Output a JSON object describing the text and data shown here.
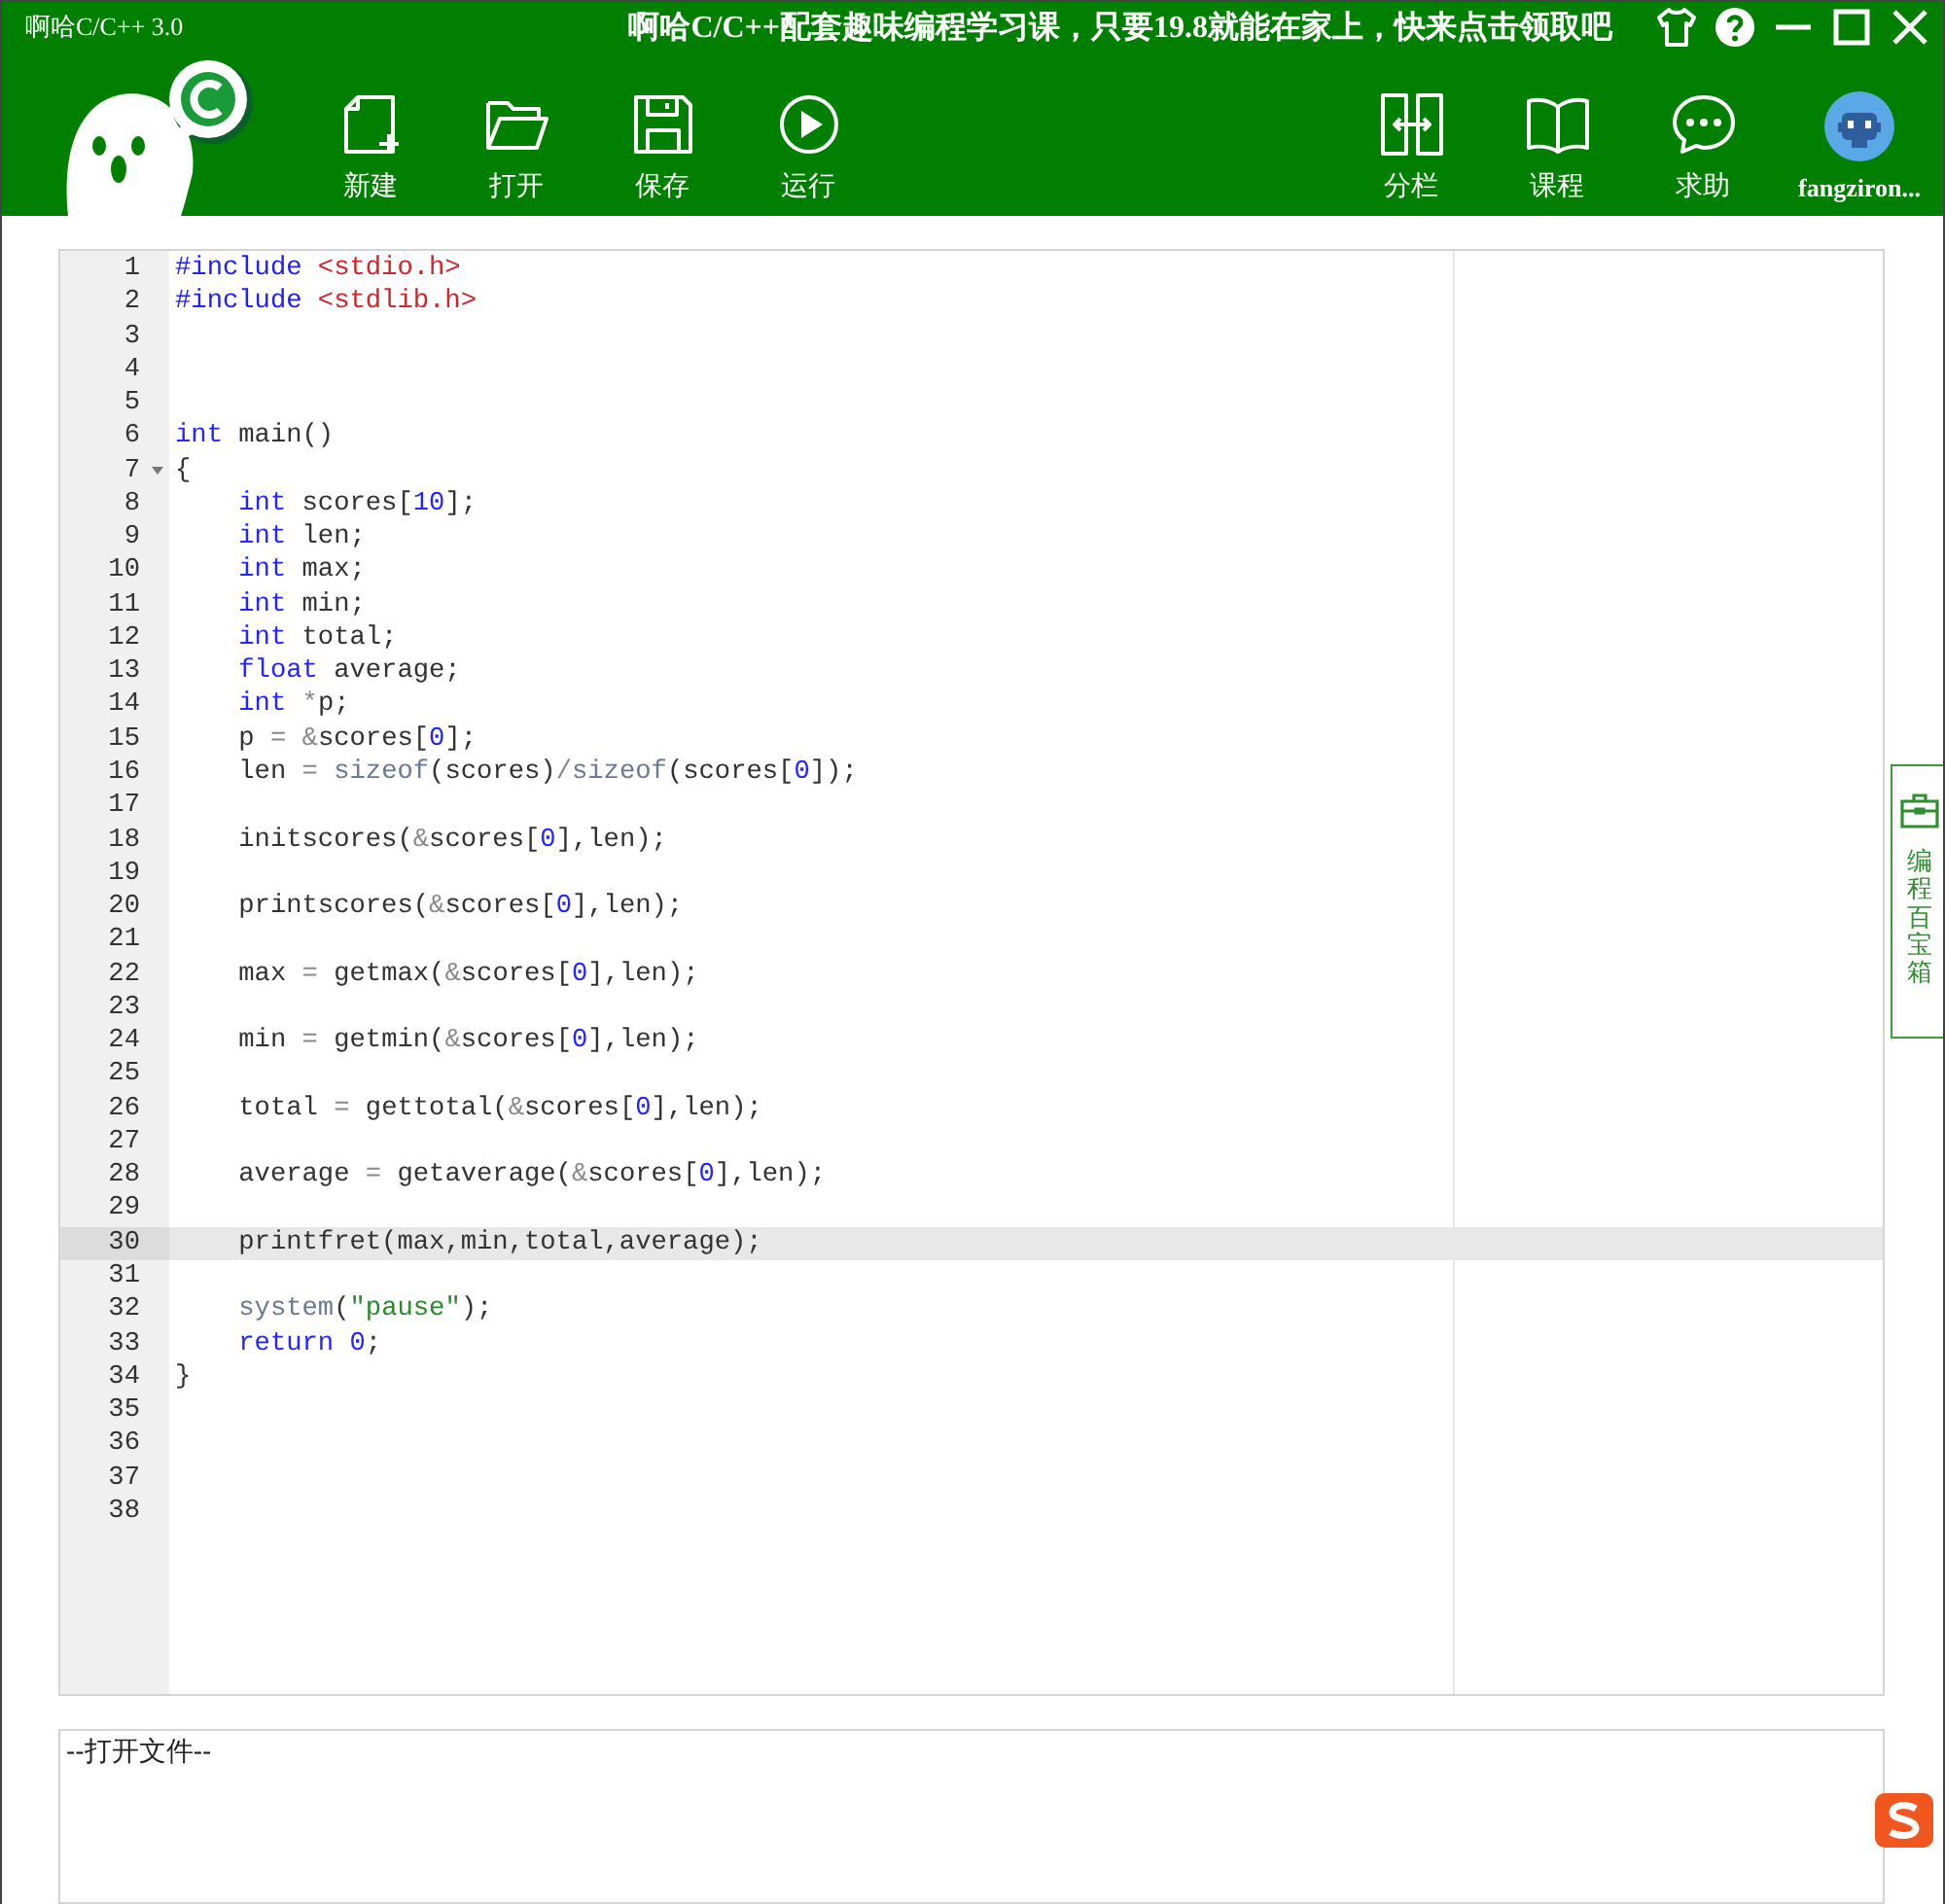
{
  "window": {
    "title": "啊哈C/C++ 3.0",
    "promo": "啊哈C/C++配套趣味编程学习课，只要19.8就能在家上，快来点击领取吧"
  },
  "toolbar": {
    "left": [
      {
        "label": "新建",
        "kind": "new"
      },
      {
        "label": "打开",
        "kind": "open"
      },
      {
        "label": "保存",
        "kind": "save"
      },
      {
        "label": "运行",
        "kind": "run"
      }
    ],
    "right": [
      {
        "label": "分栏",
        "kind": "split"
      },
      {
        "label": "课程",
        "kind": "book"
      },
      {
        "label": "求助",
        "kind": "chat"
      }
    ],
    "user": {
      "name": "fangziron..."
    }
  },
  "editor": {
    "lines": [
      {
        "num": "1",
        "current": false,
        "foldable": false,
        "tokens": [
          {
            "kind": "pre",
            "text": "#include"
          },
          {
            "kind": "hdr",
            "text": " <stdio.h>"
          }
        ]
      },
      {
        "num": "2",
        "current": false,
        "foldable": false,
        "tokens": [
          {
            "kind": "pre",
            "text": "#include"
          },
          {
            "kind": "hdr",
            "text": " <stdlib.h>"
          }
        ]
      },
      {
        "num": "3",
        "current": false,
        "foldable": false
      },
      {
        "num": "4",
        "current": false,
        "foldable": false
      },
      {
        "num": "5",
        "current": false,
        "foldable": false
      },
      {
        "num": "6",
        "current": false,
        "foldable": false,
        "tokens": [
          {
            "kind": "kw",
            "text": "int"
          },
          {
            "kind": "plain",
            "text": " main()"
          }
        ]
      },
      {
        "num": "7",
        "current": false,
        "foldable": true,
        "tokens": [
          {
            "kind": "plain",
            "text": "{"
          }
        ]
      },
      {
        "num": "8",
        "current": false,
        "foldable": false,
        "tokens": [
          {
            "kind": "kw",
            "text": "    int"
          },
          {
            "kind": "plain",
            "text": " scores["
          },
          {
            "kind": "num",
            "text": "10"
          },
          {
            "kind": "plain",
            "text": "];"
          }
        ]
      },
      {
        "num": "9",
        "current": false,
        "foldable": false,
        "tokens": [
          {
            "kind": "kw",
            "text": "    int"
          },
          {
            "kind": "plain",
            "text": " len;"
          }
        ]
      },
      {
        "num": "10",
        "current": false,
        "foldable": false,
        "tokens": [
          {
            "kind": "kw",
            "text": "    int"
          },
          {
            "kind": "plain",
            "text": " max;"
          }
        ]
      },
      {
        "num": "11",
        "current": false,
        "foldable": false,
        "tokens": [
          {
            "kind": "kw",
            "text": "    int"
          },
          {
            "kind": "plain",
            "text": " min;"
          }
        ]
      },
      {
        "num": "12",
        "current": false,
        "foldable": false,
        "tokens": [
          {
            "kind": "kw",
            "text": "    int"
          },
          {
            "kind": "plain",
            "text": " total;"
          }
        ]
      },
      {
        "num": "13",
        "current": false,
        "foldable": false,
        "tokens": [
          {
            "kind": "kw",
            "text": "    float"
          },
          {
            "kind": "plain",
            "text": " average;"
          }
        ]
      },
      {
        "num": "14",
        "current": false,
        "foldable": false,
        "tokens": [
          {
            "kind": "kw",
            "text": "    int"
          },
          {
            "kind": "op",
            "text": " *"
          },
          {
            "kind": "plain",
            "text": "p;"
          }
        ]
      },
      {
        "num": "15",
        "current": false,
        "foldable": false,
        "tokens": [
          {
            "kind": "plain",
            "text": "    p"
          },
          {
            "kind": "op",
            "text": " = &"
          },
          {
            "kind": "plain",
            "text": "scores["
          },
          {
            "kind": "num",
            "text": "0"
          },
          {
            "kind": "plain",
            "text": "];"
          }
        ]
      },
      {
        "num": "16",
        "current": false,
        "foldable": false,
        "tokens": [
          {
            "kind": "plain",
            "text": "    len"
          },
          {
            "kind": "op",
            "text": " ="
          },
          {
            "kind": "fn",
            "text": " sizeof"
          },
          {
            "kind": "plain",
            "text": "(scores)"
          },
          {
            "kind": "op",
            "text": "/"
          },
          {
            "kind": "fn",
            "text": "sizeof"
          },
          {
            "kind": "plain",
            "text": "(scores["
          },
          {
            "kind": "num",
            "text": "0"
          },
          {
            "kind": "plain",
            "text": "]);"
          }
        ]
      },
      {
        "num": "17",
        "current": false,
        "foldable": false
      },
      {
        "num": "18",
        "current": false,
        "foldable": false,
        "tokens": [
          {
            "kind": "plain",
            "text": "    initscores("
          },
          {
            "kind": "op",
            "text": "&"
          },
          {
            "kind": "plain",
            "text": "scores["
          },
          {
            "kind": "num",
            "text": "0"
          },
          {
            "kind": "plain",
            "text": "],len);"
          }
        ]
      },
      {
        "num": "19",
        "current": false,
        "foldable": false
      },
      {
        "num": "20",
        "current": false,
        "foldable": false,
        "tokens": [
          {
            "kind": "plain",
            "text": "    printscores("
          },
          {
            "kind": "op",
            "text": "&"
          },
          {
            "kind": "plain",
            "text": "scores["
          },
          {
            "kind": "num",
            "text": "0"
          },
          {
            "kind": "plain",
            "text": "],len);"
          }
        ]
      },
      {
        "num": "21",
        "current": false,
        "foldable": false
      },
      {
        "num": "22",
        "current": false,
        "foldable": false,
        "tokens": [
          {
            "kind": "plain",
            "text": "    max"
          },
          {
            "kind": "op",
            "text": " ="
          },
          {
            "kind": "plain",
            "text": " getmax("
          },
          {
            "kind": "op",
            "text": "&"
          },
          {
            "kind": "plain",
            "text": "scores["
          },
          {
            "kind": "num",
            "text": "0"
          },
          {
            "kind": "plain",
            "text": "],len);"
          }
        ]
      },
      {
        "num": "23",
        "current": false,
        "foldable": false
      },
      {
        "num": "24",
        "current": false,
        "foldable": false,
        "tokens": [
          {
            "kind": "plain",
            "text": "    min"
          },
          {
            "kind": "op",
            "text": " ="
          },
          {
            "kind": "plain",
            "text": " getmin("
          },
          {
            "kind": "op",
            "text": "&"
          },
          {
            "kind": "plain",
            "text": "scores["
          },
          {
            "kind": "num",
            "text": "0"
          },
          {
            "kind": "plain",
            "text": "],len);"
          }
        ]
      },
      {
        "num": "25",
        "current": false,
        "foldable": false
      },
      {
        "num": "26",
        "current": false,
        "foldable": false,
        "tokens": [
          {
            "kind": "plain",
            "text": "    total"
          },
          {
            "kind": "op",
            "text": " ="
          },
          {
            "kind": "plain",
            "text": " gettotal("
          },
          {
            "kind": "op",
            "text": "&"
          },
          {
            "kind": "plain",
            "text": "scores["
          },
          {
            "kind": "num",
            "text": "0"
          },
          {
            "kind": "plain",
            "text": "],len);"
          }
        ]
      },
      {
        "num": "27",
        "current": false,
        "foldable": false
      },
      {
        "num": "28",
        "current": false,
        "foldable": false,
        "tokens": [
          {
            "kind": "plain",
            "text": "    average"
          },
          {
            "kind": "op",
            "text": " ="
          },
          {
            "kind": "plain",
            "text": " getaverage("
          },
          {
            "kind": "op",
            "text": "&"
          },
          {
            "kind": "plain",
            "text": "scores["
          },
          {
            "kind": "num",
            "text": "0"
          },
          {
            "kind": "plain",
            "text": "],len);"
          }
        ]
      },
      {
        "num": "29",
        "current": false,
        "foldable": false
      },
      {
        "num": "30",
        "current": true,
        "foldable": false,
        "tokens": [
          {
            "kind": "plain",
            "text": "    printfret(max,min,total,average);"
          }
        ]
      },
      {
        "num": "31",
        "current": false,
        "foldable": false
      },
      {
        "num": "32",
        "current": false,
        "foldable": false,
        "tokens": [
          {
            "kind": "fn",
            "text": "    system"
          },
          {
            "kind": "plain",
            "text": "("
          },
          {
            "kind": "str",
            "text": "\"pause\""
          },
          {
            "kind": "plain",
            "text": ");"
          }
        ]
      },
      {
        "num": "33",
        "current": false,
        "foldable": false,
        "tokens": [
          {
            "kind": "kw",
            "text": "    return"
          },
          {
            "kind": "num",
            "text": " 0"
          },
          {
            "kind": "plain",
            "text": ";"
          }
        ]
      },
      {
        "num": "34",
        "current": false,
        "foldable": false,
        "tokens": [
          {
            "kind": "plain",
            "text": "}"
          }
        ]
      },
      {
        "num": "35",
        "current": false,
        "foldable": false
      },
      {
        "num": "36",
        "current": false,
        "foldable": false
      },
      {
        "num": "37",
        "current": false,
        "foldable": false
      },
      {
        "num": "38",
        "current": false,
        "foldable": false
      }
    ]
  },
  "side_tab": {
    "label": "编程百宝箱"
  },
  "output": {
    "text": "--打开文件--"
  }
}
